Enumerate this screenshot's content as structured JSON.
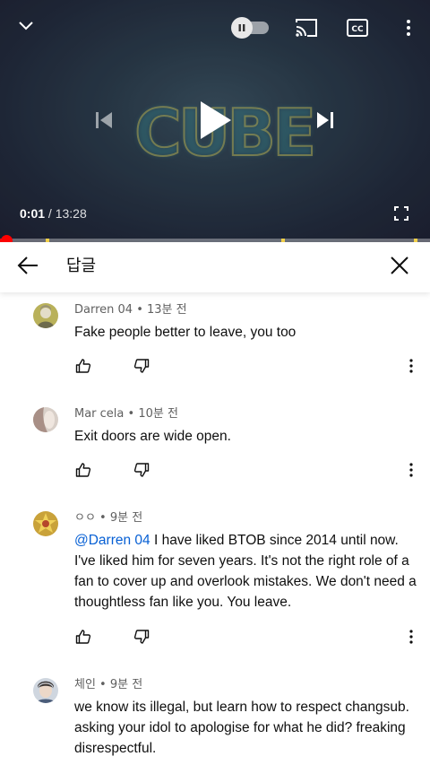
{
  "player": {
    "current_time": "0:01",
    "separator": " / ",
    "duration": "13:28",
    "progress_fraction": 0.001,
    "ad_markers_fraction": [
      0.107,
      0.654,
      0.963
    ],
    "icons": {
      "collapse": "chevron-down-icon",
      "autoplay": "autoplay-toggle",
      "cast": "cast-icon",
      "captions": "closed-captions-icon",
      "more": "more-vert-icon",
      "previous": "skip-previous-icon",
      "play": "play-icon",
      "next": "skip-next-icon",
      "fullscreen": "fullscreen-icon"
    },
    "accent": "#ff0000"
  },
  "replies": {
    "title": "답글"
  },
  "comments": [
    {
      "author": "Darren 04",
      "time": "13분 전",
      "text": "Fake people better to leave, you too",
      "mention": ""
    },
    {
      "author": "Mar cela",
      "time": "10분 전",
      "text": "Exit doors are wide open.",
      "mention": ""
    },
    {
      "author": "ㅇㅇ",
      "time": "9분 전",
      "mention": "@Darren 04",
      "text": " I have liked BTOB since 2014 until now. I've liked him for seven years. It's not the right role of a fan to cover up and overlook mistakes. We don't need a thoughtless fan like you. You leave."
    },
    {
      "author": "체인",
      "time": "9분 전",
      "text": "we know its illegal, but learn how to respect changsub. asking your idol to apologise for what he did? freaking disrespectful.",
      "mention": ""
    }
  ],
  "meta_dot": " • "
}
